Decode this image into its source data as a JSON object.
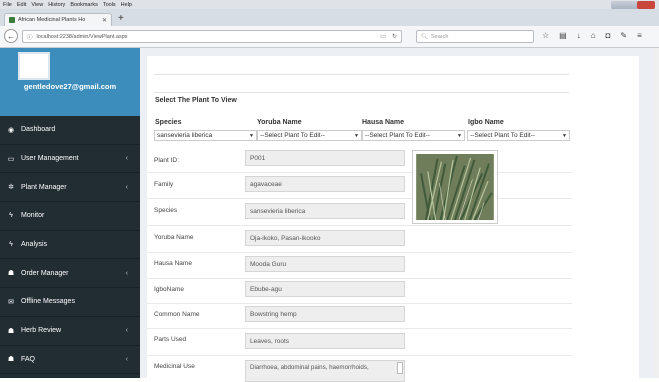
{
  "browser": {
    "menu": [
      "File",
      "Edit",
      "View",
      "History",
      "Bookmarks",
      "Tools",
      "Help"
    ],
    "tab_title": "African Medicinal Plants Ho",
    "url": "localhost:2238/admin/ViewPlant.aspx",
    "search_placeholder": "Search"
  },
  "sidebar": {
    "email": "gentledove27@gmail.com",
    "items": [
      {
        "label": "Dashboard",
        "icon": "dashboard-icon",
        "glyph": "◉",
        "chev": ""
      },
      {
        "label": "User Management",
        "icon": "monitor-icon",
        "glyph": "▭",
        "chev": "‹"
      },
      {
        "label": "Plant Manager",
        "icon": "plant-icon",
        "glyph": "✲",
        "chev": "‹"
      },
      {
        "label": "Monitor",
        "icon": "bolt-icon",
        "glyph": "ϟ",
        "chev": ""
      },
      {
        "label": "Analysis",
        "icon": "bolt-icon",
        "glyph": "ϟ",
        "chev": ""
      },
      {
        "label": "Order Manager",
        "icon": "group-icon",
        "glyph": "☗",
        "chev": "‹"
      },
      {
        "label": "Offline Messages",
        "icon": "envelope-icon",
        "glyph": "✉",
        "chev": ""
      },
      {
        "label": "Herb Review",
        "icon": "group-icon",
        "glyph": "☗",
        "chev": "‹"
      },
      {
        "label": "FAQ",
        "icon": "group-icon",
        "glyph": "☗",
        "chev": "‹"
      }
    ]
  },
  "form": {
    "select_title": "Select The Plant To View",
    "headers": {
      "species": "Species",
      "yoruba": "Yoruba Name",
      "hausa": "Hausa Name",
      "igbo": "Igbo Name"
    },
    "selects": {
      "species": "sansevieria liberica",
      "yoruba": "--Select Plant To Edit--",
      "hausa": "--Select Plant To Edit--",
      "igbo": "--Select Plant To Edit--"
    },
    "fields": [
      {
        "label": "Plant ID:",
        "value": "P001"
      },
      {
        "label": "Family",
        "value": "agavaceae"
      },
      {
        "label": "Species",
        "value": "sansevieria liberica"
      },
      {
        "label": "Yoruba Name",
        "value": "Oja-ikoko, Pasan-ikooko"
      },
      {
        "label": "Hausa Name",
        "value": "Mooda Guru"
      },
      {
        "label": "IgboName",
        "value": "Ebube-agu"
      },
      {
        "label": "Common Name",
        "value": "Bowstring hemp"
      },
      {
        "label": "Parts Used",
        "value": "Leaves, roots"
      }
    ],
    "medicinal_label": "Medicinal Use",
    "medicinal_value": "Diarrhoea, abdominal pains, haemorrhoids,"
  }
}
